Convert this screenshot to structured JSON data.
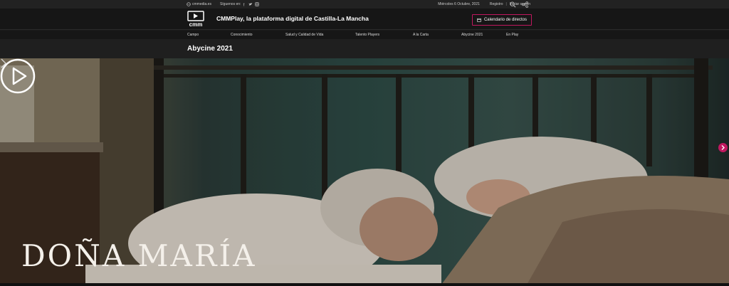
{
  "topbar": {
    "site": "cmmedia.es",
    "follow_label": "Síguenos en:",
    "date": "Miércoles 6 Octubre, 2021",
    "register": "Registro",
    "separator": "|",
    "login": "Iniciar sesión"
  },
  "header": {
    "logo_text": "cmm",
    "title": "CMMPlay, la plataforma digital de Castilla-La Mancha",
    "live_button": "Calendario de directos"
  },
  "nav": {
    "items": [
      {
        "label": "Campo"
      },
      {
        "label": "Conocimiento"
      },
      {
        "label": "Salud y Calidad de Vida"
      },
      {
        "label": "Talento Players"
      },
      {
        "label": "A la Carta"
      },
      {
        "label": "Abycine 2021"
      },
      {
        "label": "En Play"
      }
    ]
  },
  "section": {
    "title": "Abycine 2021"
  },
  "hero": {
    "title": "DOÑA MARÍA"
  },
  "colors": {
    "accent": "#c0185f",
    "background": "#161616"
  }
}
